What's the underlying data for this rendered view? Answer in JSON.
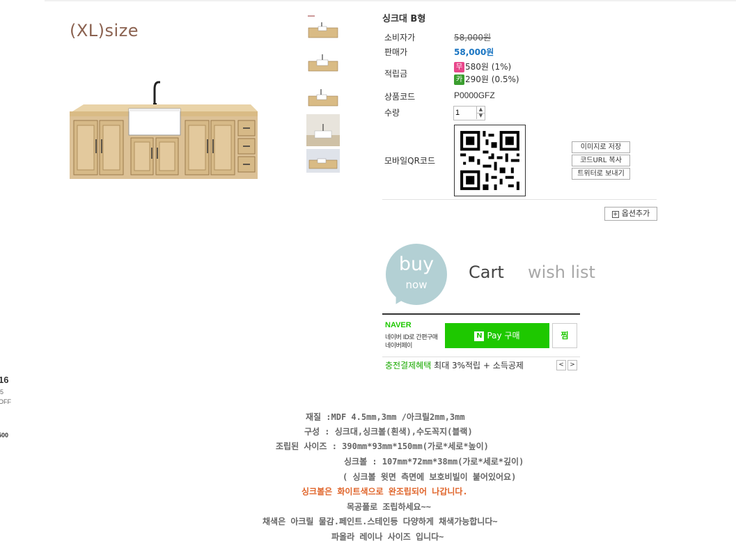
{
  "product": {
    "size_label": "(XL)size",
    "title": "싱크대 B형",
    "labels": {
      "consumer_price": "소비자가",
      "sale_price": "판매가",
      "points": "적립금",
      "product_code": "상품코드",
      "quantity": "수량",
      "mobile_qr": "모바일QR코드"
    },
    "consumer_price": "58,000원",
    "sale_price": "58,000원",
    "points": [
      {
        "badge": "무",
        "text": "580원 (1%)"
      },
      {
        "badge": "카",
        "text": "290원 (0.5%)"
      }
    ],
    "product_code": "P0000GFZ",
    "quantity": "1"
  },
  "qr_actions": {
    "save_image": "이미지로 저장",
    "copy_url": "코드URL 복사",
    "send_twitter": "트위터로 보내기"
  },
  "option_add": "옵션추가",
  "purchase": {
    "buy": "buy",
    "now": "now",
    "cart": "Cart",
    "wishlist": "wish list"
  },
  "naverpay": {
    "brand": "NAVER",
    "sub1": "네이버 ID로 간편구매",
    "sub2": "네이버페이",
    "pay_label": "Pay 구매",
    "zzim": "찜",
    "benefit_highlight": "충전결제혜택",
    "benefit_text": "최대 3%적립 + 소득공제"
  },
  "side_widget": {
    "num": "16",
    "sub1": "5",
    "sub2": "OFF",
    "price": "500"
  },
  "description": [
    "재질 :MDF 4.5mm,3mm /아크릴2mm,3mm",
    "구성 : 싱크대,싱크볼(흰색),수도꼭지(블랙)",
    "조립된 사이즈  : 390mm*93mm*150mm(가로*세로*높이)",
    "싱크볼 : 107mm*72mm*38mm(가로*세로*깊이)",
    "( 싱크볼 윗면 측면에  보호비빌이 붙어있어요)",
    "싱크볼은 화이트색으로 완조립되어 나갑니다.",
    "목공풀로 조립하세요~~",
    "채색은 아크릴 물감.페인트.스테인등 다양하게 채색가능합니다~",
    "파올라 레이나 사이즈 입니다~"
  ],
  "colors": {
    "sale": "#1a75c2",
    "naver_green": "#1ec800",
    "buy_circle": "#b3d0d4",
    "highlight_orange": "#e0652b"
  }
}
